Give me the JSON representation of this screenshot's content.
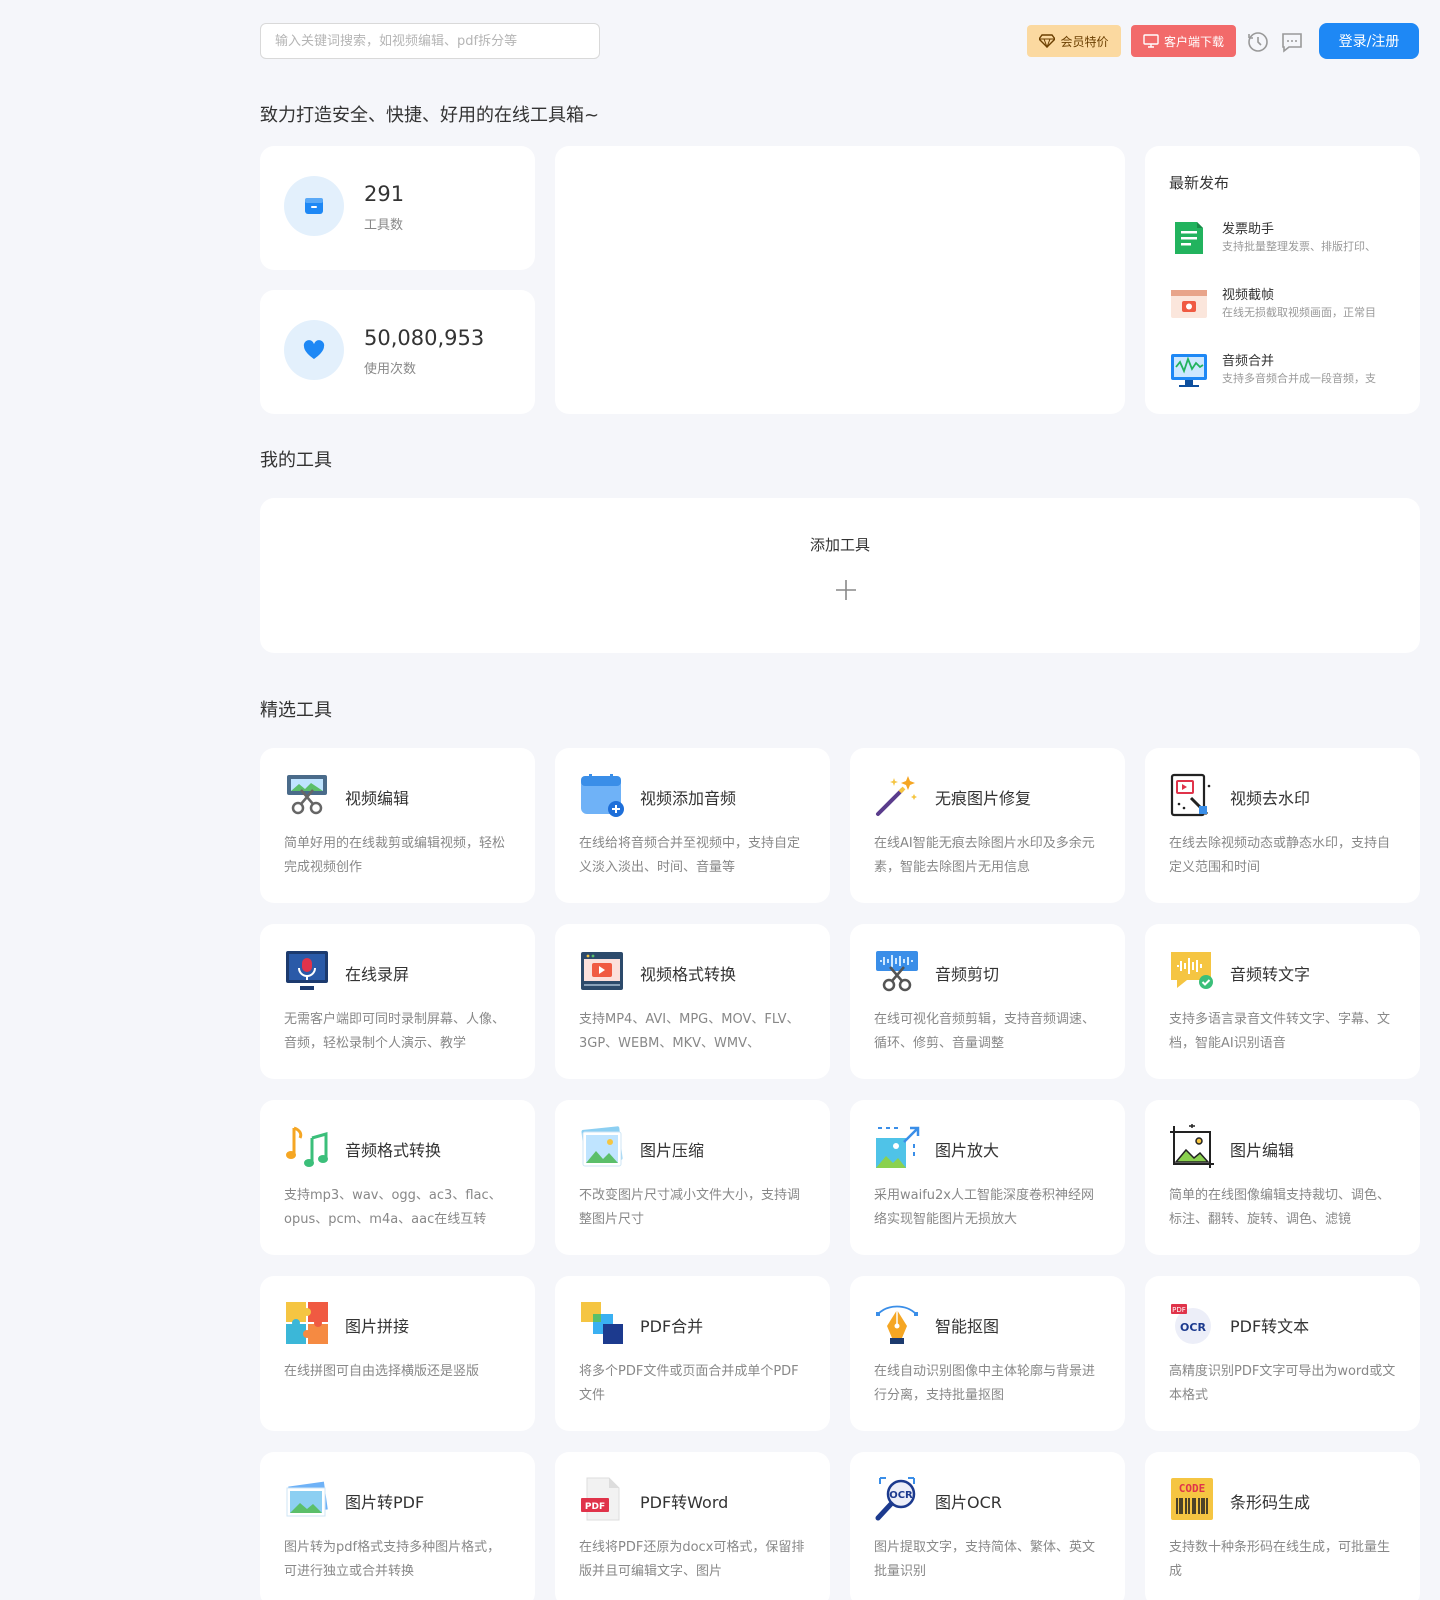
{
  "header": {
    "search_placeholder": "输入关键词搜索，如视频编辑、pdf拆分等",
    "vip_label": "会员特价",
    "download_label": "客户端下载",
    "login_label": "登录/注册"
  },
  "tagline": "致力打造安全、快捷、好用的在线工具箱~",
  "stats": {
    "tools_count": "291",
    "tools_label": "工具数",
    "uses_count": "50,080,953",
    "uses_label": "使用次数"
  },
  "latest": {
    "title": "最新发布",
    "items": [
      {
        "name": "发票助手",
        "desc": "支持批量整理发票、排版打印、",
        "icon": "invoice-icon"
      },
      {
        "name": "视频截帧",
        "desc": "在线无损截取视频画面，正常目",
        "icon": "video-frame-icon"
      },
      {
        "name": "音频合并",
        "desc": "支持多音频合并成一段音频，支",
        "icon": "audio-merge-icon"
      }
    ]
  },
  "my_tools": {
    "title": "我的工具",
    "add_label": "添加工具"
  },
  "featured": {
    "title": "精选工具",
    "tools": [
      {
        "name": "视频编辑",
        "desc": "简单好用的在线裁剪或编辑视频，轻松完成视频创作",
        "icon": "video-edit-icon"
      },
      {
        "name": "视频添加音频",
        "desc": "在线给将音频合并至视频中，支持自定义淡入淡出、时间、音量等",
        "icon": "video-add-audio-icon"
      },
      {
        "name": "无痕图片修复",
        "desc": "在线AI智能无痕去除图片水印及多余元素，智能去除图片无用信息",
        "icon": "magic-wand-icon"
      },
      {
        "name": "视频去水印",
        "desc": "在线去除视频动态或静态水印，支持自定义范围和时间",
        "icon": "video-watermark-icon"
      },
      {
        "name": "在线录屏",
        "desc": "无需客户端即可同时录制屏幕、人像、音频，轻松录制个人演示、教学",
        "icon": "screen-record-icon"
      },
      {
        "name": "视频格式转换",
        "desc": "支持MP4、AVI、MPG、MOV、FLV、3GP、WEBM、MKV、WMV、",
        "icon": "video-convert-icon"
      },
      {
        "name": "音频剪切",
        "desc": "在线可视化音频剪辑，支持音频调速、循环、修剪、音量调整",
        "icon": "audio-cut-icon"
      },
      {
        "name": "音频转文字",
        "desc": "支持多语言录音文件转文字、字幕、文档，智能AI识别语音",
        "icon": "audio-text-icon"
      },
      {
        "name": "音频格式转换",
        "desc": "支持mp3、wav、ogg、ac3、flac、opus、pcm、m4a、aac在线互转",
        "icon": "music-note-icon"
      },
      {
        "name": "图片压缩",
        "desc": "不改变图片尺寸减小文件大小，支持调整图片尺寸",
        "icon": "image-compress-icon"
      },
      {
        "name": "图片放大",
        "desc": "采用waifu2x人工智能深度卷积神经网络实现智能图片无损放大",
        "icon": "image-enlarge-icon"
      },
      {
        "name": "图片编辑",
        "desc": "简单的在线图像编辑支持裁切、调色、标注、翻转、旋转、调色、滤镜",
        "icon": "image-edit-icon"
      },
      {
        "name": "图片拼接",
        "desc": "在线拼图可自由选择横版还是竖版",
        "icon": "puzzle-icon"
      },
      {
        "name": "PDF合并",
        "desc": "将多个PDF文件或页面合并成单个PDF文件",
        "icon": "pdf-merge-icon"
      },
      {
        "name": "智能抠图",
        "desc": "在线自动识别图像中主体轮廓与背景进行分离，支持批量抠图",
        "icon": "pen-tool-icon"
      },
      {
        "name": "PDF转文本",
        "desc": "高精度识别PDF文字可导出为word或文本格式",
        "icon": "pdf-ocr-icon"
      },
      {
        "name": "图片转PDF",
        "desc": "图片转为pdf格式支持多种图片格式，可进行独立或合并转换",
        "icon": "image-pdf-icon"
      },
      {
        "name": "PDF转Word",
        "desc": "在线将PDF还原为docx可格式，保留排版并且可编辑文字、图片",
        "icon": "pdf-word-icon"
      },
      {
        "name": "图片OCR",
        "desc": "图片提取文字，支持简体、繁体、英文批量识别",
        "icon": "ocr-icon"
      },
      {
        "name": "条形码生成",
        "desc": "支持数十种条形码在线生成，可批量生成",
        "icon": "barcode-icon"
      }
    ]
  }
}
